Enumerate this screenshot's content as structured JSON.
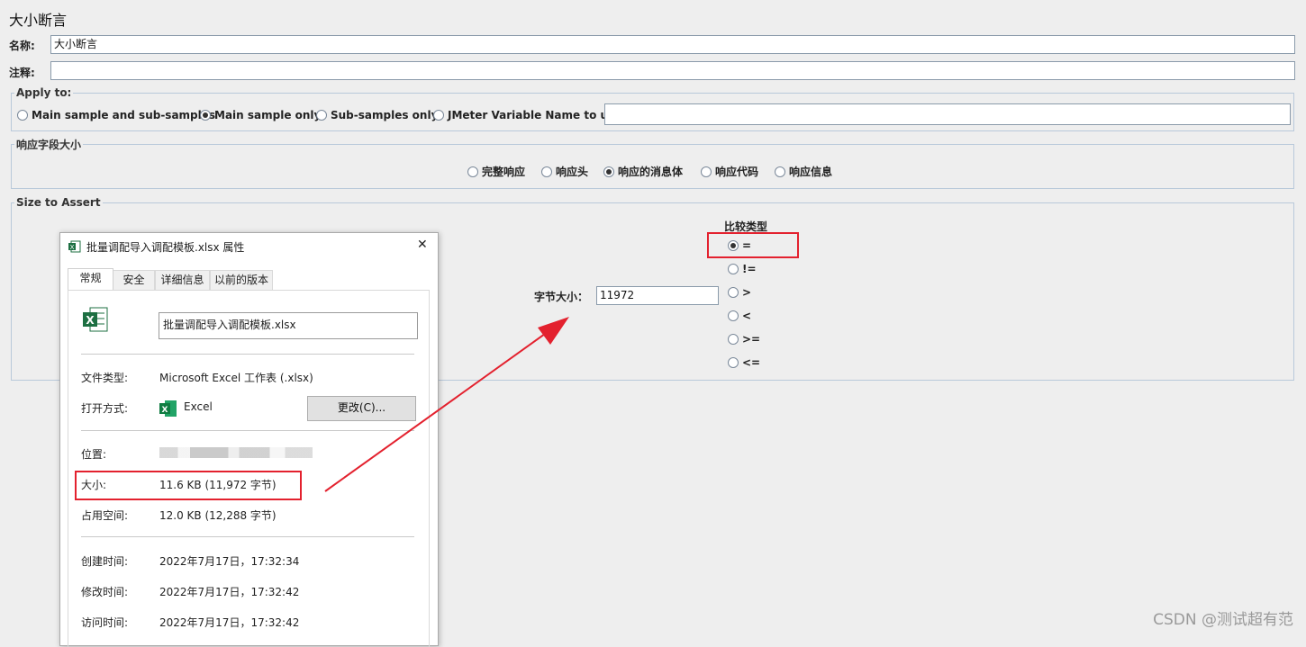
{
  "page": {
    "title": "大小断言"
  },
  "fields": {
    "name_label": "名称:",
    "name_value": "大小断言",
    "comment_label": "注释:",
    "comment_value": ""
  },
  "apply_to": {
    "legend": "Apply to:",
    "options": [
      {
        "label": "Main sample and sub-samples",
        "selected": false
      },
      {
        "label": "Main sample only",
        "selected": true
      },
      {
        "label": "Sub-samples only",
        "selected": false
      },
      {
        "label": "JMeter Variable Name to use",
        "selected": false
      }
    ],
    "variable_value": ""
  },
  "response_field": {
    "legend": "响应字段大小",
    "options": [
      {
        "label": "完整响应",
        "selected": false
      },
      {
        "label": "响应头",
        "selected": false
      },
      {
        "label": "响应的消息体",
        "selected": true
      },
      {
        "label": "响应代码",
        "selected": false
      },
      {
        "label": "响应信息",
        "selected": false
      }
    ]
  },
  "size_to_assert": {
    "legend": "Size to Assert",
    "byte_size_label": "字节大小：",
    "byte_size_value": "11972",
    "compare_type_label": "比较类型",
    "compare_options": [
      {
        "label": "=",
        "selected": true
      },
      {
        "label": "!=",
        "selected": false
      },
      {
        "label": ">",
        "selected": false
      },
      {
        "label": "<",
        "selected": false
      },
      {
        "label": ">=",
        "selected": false
      },
      {
        "label": "<=",
        "selected": false
      }
    ]
  },
  "dialog": {
    "title": "批量调配导入调配模板.xlsx 属性",
    "close_glyph": "✕",
    "tabs": [
      "常规",
      "安全",
      "详细信息",
      "以前的版本"
    ],
    "file_name": "批量调配导入调配模板.xlsx",
    "file_type_label": "文件类型:",
    "file_type_value": "Microsoft Excel 工作表 (.xlsx)",
    "open_with_label": "打开方式:",
    "open_with_value": "Excel",
    "change_button": "更改(C)...",
    "location_label": "位置:",
    "size_label": "大小:",
    "size_value": "11.6 KB (11,972 字节)",
    "disk_size_label": "占用空间:",
    "disk_size_value": "12.0 KB (12,288 字节)",
    "created_label": "创建时间:",
    "created_value": "2022年7月17日，17:32:34",
    "modified_label": "修改时间:",
    "modified_value": "2022年7月17日，17:32:42",
    "accessed_label": "访问时间:",
    "accessed_value": "2022年7月17日，17:32:42"
  },
  "watermark": "CSDN @测试超有范",
  "colors": {
    "highlight": "#e3212e",
    "excel_green": "#1d6f42",
    "fieldset_border": "#b9c9da"
  }
}
